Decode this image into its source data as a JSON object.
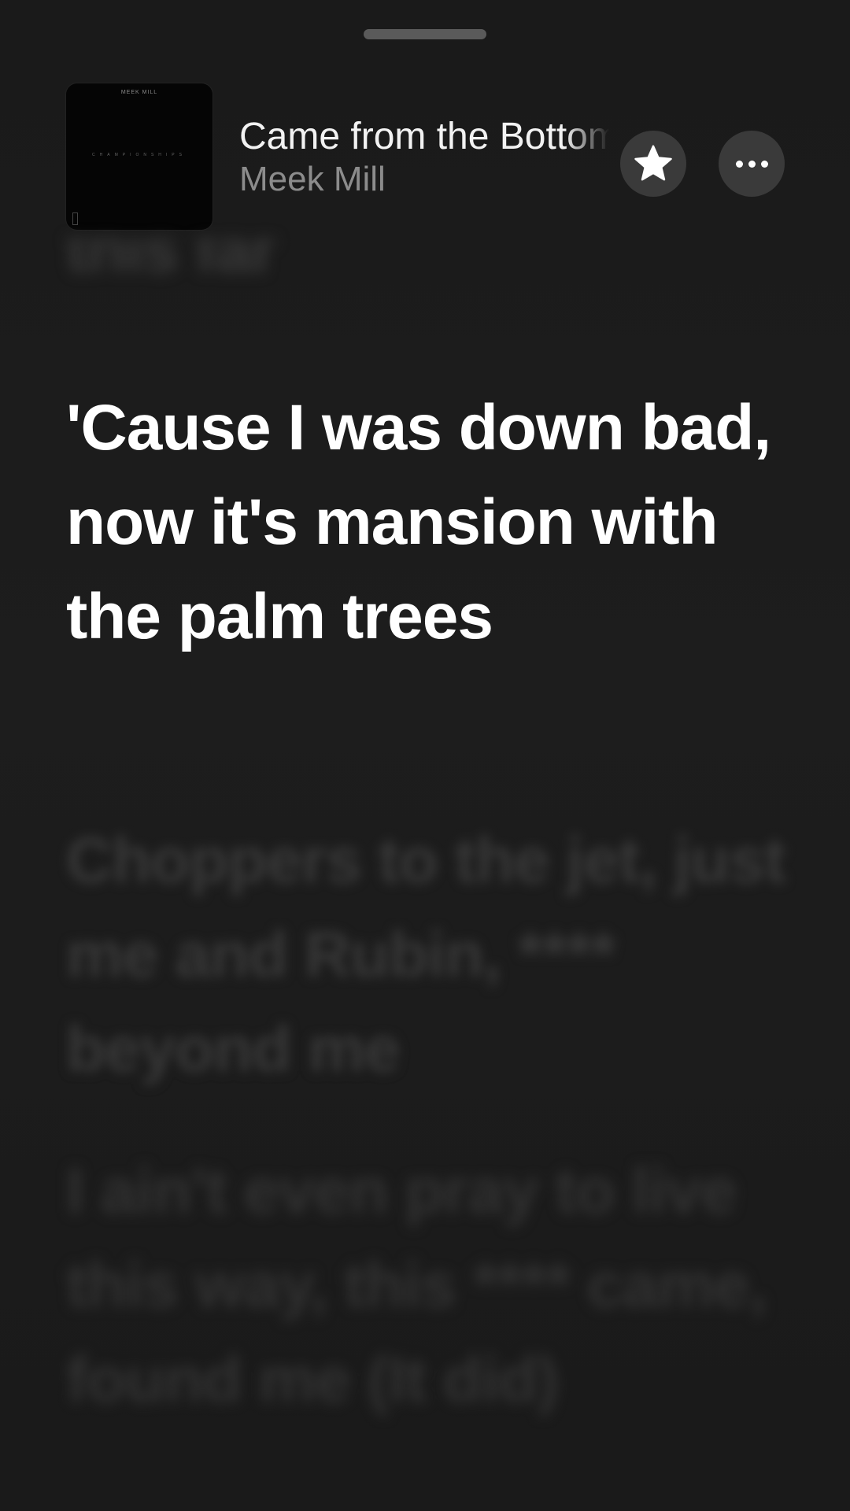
{
  "now_playing": {
    "title": "Came from the Bottom",
    "artist": "Meek Mill",
    "album_art": {
      "top_text": "MEEK MILL",
      "center_text": "CHAMPIONSHIPS"
    }
  },
  "actions": {
    "favorite_icon": "star-icon",
    "more_icon": "ellipsis-icon"
  },
  "lyrics": {
    "previous": "this far",
    "current": "'Cause I was down bad, now it's mansion with the palm trees",
    "next": [
      "Choppers to the jet, just me and Rubin, **** beyond me",
      "I ain't even pray to live this way, this **** came, found me (It did)"
    ]
  },
  "colors": {
    "background": "#1b1b1b",
    "active_lyric": "#ffffff",
    "inactive_lyric": "#383838",
    "artist_text": "#8c8c8c",
    "button_bg": "#3a3a3a"
  }
}
